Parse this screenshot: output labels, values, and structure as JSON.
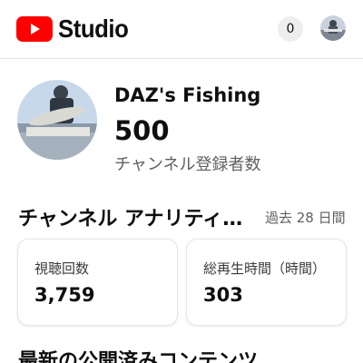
{
  "header": {
    "app_name": "Studio",
    "logo_icon": "youtube-play-icon",
    "notification_count": "0",
    "brand_color": "#ff0000"
  },
  "channel": {
    "name": "DAZ's Fishing",
    "subscribers": "500",
    "subscribers_label": "チャンネル登録者数"
  },
  "analytics": {
    "title": "チャンネル アナリティクス",
    "period": "過去 28 日間",
    "cards": [
      {
        "label": "視聴回数",
        "value": "3,759"
      },
      {
        "label": "総再生時間（時間）",
        "value": "303"
      }
    ]
  },
  "next_section": {
    "title": "最新の公開済みコンテンツ"
  }
}
